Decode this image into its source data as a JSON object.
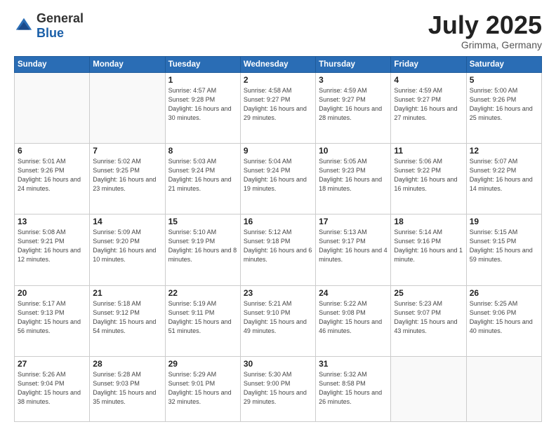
{
  "logo": {
    "general": "General",
    "blue": "Blue"
  },
  "title": "July 2025",
  "location": "Grimma, Germany",
  "weekdays": [
    "Sunday",
    "Monday",
    "Tuesday",
    "Wednesday",
    "Thursday",
    "Friday",
    "Saturday"
  ],
  "weeks": [
    [
      {
        "day": "",
        "info": ""
      },
      {
        "day": "",
        "info": ""
      },
      {
        "day": "1",
        "info": "Sunrise: 4:57 AM\nSunset: 9:28 PM\nDaylight: 16 hours\nand 30 minutes."
      },
      {
        "day": "2",
        "info": "Sunrise: 4:58 AM\nSunset: 9:27 PM\nDaylight: 16 hours\nand 29 minutes."
      },
      {
        "day": "3",
        "info": "Sunrise: 4:59 AM\nSunset: 9:27 PM\nDaylight: 16 hours\nand 28 minutes."
      },
      {
        "day": "4",
        "info": "Sunrise: 4:59 AM\nSunset: 9:27 PM\nDaylight: 16 hours\nand 27 minutes."
      },
      {
        "day": "5",
        "info": "Sunrise: 5:00 AM\nSunset: 9:26 PM\nDaylight: 16 hours\nand 25 minutes."
      }
    ],
    [
      {
        "day": "6",
        "info": "Sunrise: 5:01 AM\nSunset: 9:26 PM\nDaylight: 16 hours\nand 24 minutes."
      },
      {
        "day": "7",
        "info": "Sunrise: 5:02 AM\nSunset: 9:25 PM\nDaylight: 16 hours\nand 23 minutes."
      },
      {
        "day": "8",
        "info": "Sunrise: 5:03 AM\nSunset: 9:24 PM\nDaylight: 16 hours\nand 21 minutes."
      },
      {
        "day": "9",
        "info": "Sunrise: 5:04 AM\nSunset: 9:24 PM\nDaylight: 16 hours\nand 19 minutes."
      },
      {
        "day": "10",
        "info": "Sunrise: 5:05 AM\nSunset: 9:23 PM\nDaylight: 16 hours\nand 18 minutes."
      },
      {
        "day": "11",
        "info": "Sunrise: 5:06 AM\nSunset: 9:22 PM\nDaylight: 16 hours\nand 16 minutes."
      },
      {
        "day": "12",
        "info": "Sunrise: 5:07 AM\nSunset: 9:22 PM\nDaylight: 16 hours\nand 14 minutes."
      }
    ],
    [
      {
        "day": "13",
        "info": "Sunrise: 5:08 AM\nSunset: 9:21 PM\nDaylight: 16 hours\nand 12 minutes."
      },
      {
        "day": "14",
        "info": "Sunrise: 5:09 AM\nSunset: 9:20 PM\nDaylight: 16 hours\nand 10 minutes."
      },
      {
        "day": "15",
        "info": "Sunrise: 5:10 AM\nSunset: 9:19 PM\nDaylight: 16 hours\nand 8 minutes."
      },
      {
        "day": "16",
        "info": "Sunrise: 5:12 AM\nSunset: 9:18 PM\nDaylight: 16 hours\nand 6 minutes."
      },
      {
        "day": "17",
        "info": "Sunrise: 5:13 AM\nSunset: 9:17 PM\nDaylight: 16 hours\nand 4 minutes."
      },
      {
        "day": "18",
        "info": "Sunrise: 5:14 AM\nSunset: 9:16 PM\nDaylight: 16 hours\nand 1 minute."
      },
      {
        "day": "19",
        "info": "Sunrise: 5:15 AM\nSunset: 9:15 PM\nDaylight: 15 hours\nand 59 minutes."
      }
    ],
    [
      {
        "day": "20",
        "info": "Sunrise: 5:17 AM\nSunset: 9:13 PM\nDaylight: 15 hours\nand 56 minutes."
      },
      {
        "day": "21",
        "info": "Sunrise: 5:18 AM\nSunset: 9:12 PM\nDaylight: 15 hours\nand 54 minutes."
      },
      {
        "day": "22",
        "info": "Sunrise: 5:19 AM\nSunset: 9:11 PM\nDaylight: 15 hours\nand 51 minutes."
      },
      {
        "day": "23",
        "info": "Sunrise: 5:21 AM\nSunset: 9:10 PM\nDaylight: 15 hours\nand 49 minutes."
      },
      {
        "day": "24",
        "info": "Sunrise: 5:22 AM\nSunset: 9:08 PM\nDaylight: 15 hours\nand 46 minutes."
      },
      {
        "day": "25",
        "info": "Sunrise: 5:23 AM\nSunset: 9:07 PM\nDaylight: 15 hours\nand 43 minutes."
      },
      {
        "day": "26",
        "info": "Sunrise: 5:25 AM\nSunset: 9:06 PM\nDaylight: 15 hours\nand 40 minutes."
      }
    ],
    [
      {
        "day": "27",
        "info": "Sunrise: 5:26 AM\nSunset: 9:04 PM\nDaylight: 15 hours\nand 38 minutes."
      },
      {
        "day": "28",
        "info": "Sunrise: 5:28 AM\nSunset: 9:03 PM\nDaylight: 15 hours\nand 35 minutes."
      },
      {
        "day": "29",
        "info": "Sunrise: 5:29 AM\nSunset: 9:01 PM\nDaylight: 15 hours\nand 32 minutes."
      },
      {
        "day": "30",
        "info": "Sunrise: 5:30 AM\nSunset: 9:00 PM\nDaylight: 15 hours\nand 29 minutes."
      },
      {
        "day": "31",
        "info": "Sunrise: 5:32 AM\nSunset: 8:58 PM\nDaylight: 15 hours\nand 26 minutes."
      },
      {
        "day": "",
        "info": ""
      },
      {
        "day": "",
        "info": ""
      }
    ]
  ]
}
